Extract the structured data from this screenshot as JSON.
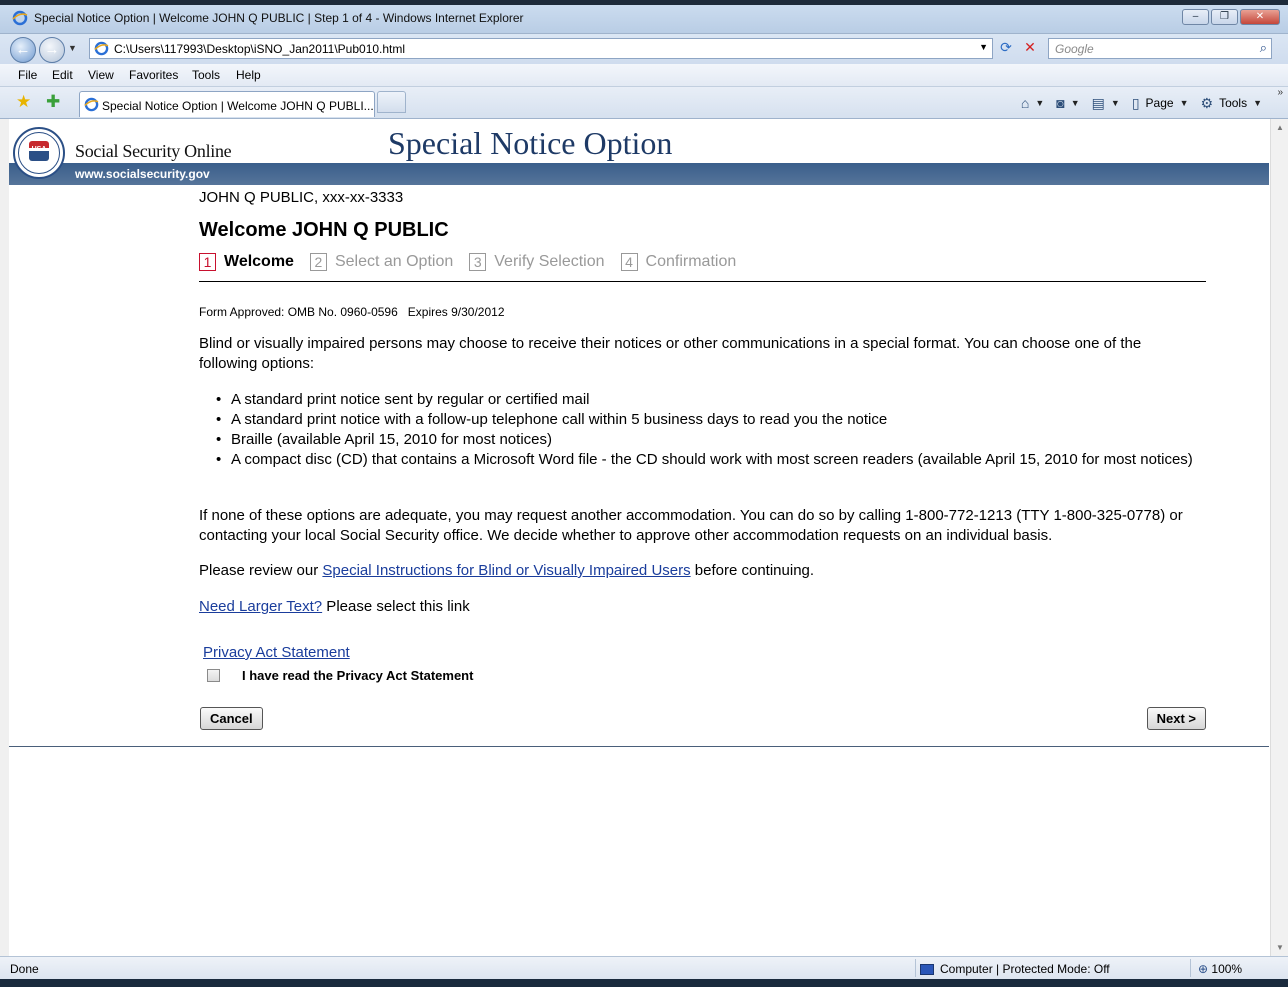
{
  "window": {
    "title": "Special Notice Option | Welcome JOHN Q PUBLIC | Step 1 of 4 - Windows Internet Explorer"
  },
  "address": {
    "url": "C:\\Users\\117993\\Desktop\\iSNO_Jan2011\\Pub010.html",
    "search_placeholder": "Google"
  },
  "menu": [
    "File",
    "Edit",
    "View",
    "Favorites",
    "Tools",
    "Help"
  ],
  "tab": {
    "label": "Special Notice Option | Welcome JOHN Q PUBLI..."
  },
  "commandbar": {
    "page": "Page",
    "tools": "Tools"
  },
  "ssa": {
    "brand": "Social Security Online",
    "site": "www.socialsecurity.gov",
    "page_title": "Special Notice Option",
    "seal_text": "USA"
  },
  "content": {
    "who": "JOHN Q PUBLIC, xxx-xx-3333",
    "welcome": "Welcome JOHN Q PUBLIC",
    "steps": [
      {
        "num": "1",
        "label": "Welcome"
      },
      {
        "num": "2",
        "label": "Select an Option"
      },
      {
        "num": "3",
        "label": "Verify Selection"
      },
      {
        "num": "4",
        "label": "Confirmation"
      }
    ],
    "omb": "Form Approved: OMB No. 0960-0596   Expires 9/30/2012",
    "intro": "Blind or visually impaired persons may choose to receive their notices or other communications in a special format. You can choose one of the following options:",
    "options": [
      "A standard print notice sent by regular or certified mail",
      "A standard print notice with a follow-up telephone call within 5 business days to read you the notice",
      "Braille (available April 15, 2010 for most notices)",
      "A compact disc (CD) that contains a Microsoft Word file - the CD should work with most screen readers (available April 15, 2010 for most notices)"
    ],
    "none": "If none of these options are adequate, you may request another accommodation. You can do so by calling 1-800-772-1213 (TTY 1-800-325-0778) or contacting your local Social Security office. We decide whether to approve other accommodation requests on an individual basis.",
    "review_pre": "Please review our ",
    "review_link": "Special Instructions for Blind or Visually Impaired Users",
    "review_post": " before continuing.",
    "larger_link": "Need Larger Text?",
    "larger_post": " Please select this link",
    "privacy_link": "Privacy Act Statement",
    "ack": "I have read the Privacy Act Statement",
    "cancel": "Cancel",
    "next": "Next >"
  },
  "status": {
    "text": "Done",
    "zone": "Computer | Protected Mode: Off",
    "zoom": "100%"
  },
  "colors": {
    "band": "#3a5e8b",
    "title": "#1e3a66",
    "link": "#1a3d9c",
    "active_step": "#c8102e"
  }
}
